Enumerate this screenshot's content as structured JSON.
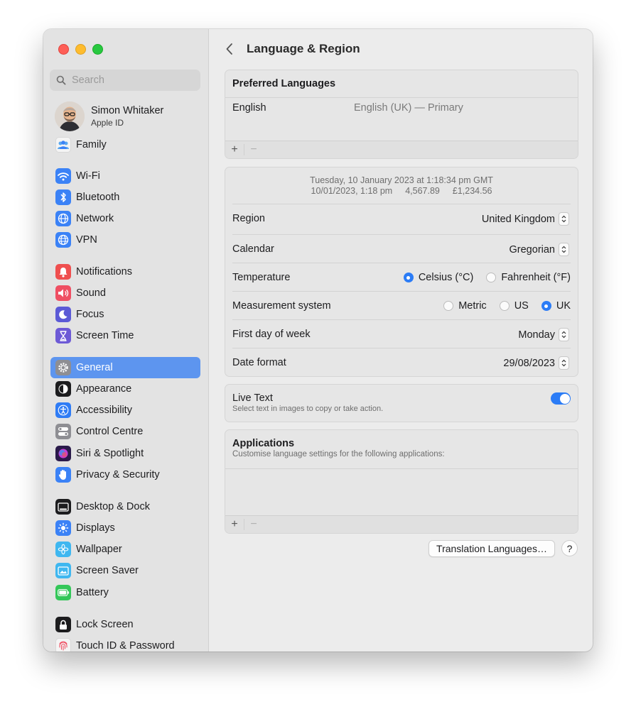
{
  "sidebar": {
    "search_placeholder": "Search",
    "profile": {
      "name": "Simon Whitaker",
      "subtitle": "Apple ID"
    },
    "items": [
      {
        "label": "Family",
        "icon": "family-icon",
        "color": "#f2f2f2"
      },
      {
        "label": "Wi-Fi",
        "icon": "wifi-icon",
        "color": "#3b82f6"
      },
      {
        "label": "Bluetooth",
        "icon": "bluetooth-icon",
        "color": "#3b82f6"
      },
      {
        "label": "Network",
        "icon": "network-globe-icon",
        "color": "#3b82f6"
      },
      {
        "label": "VPN",
        "icon": "vpn-globe-icon",
        "color": "#3b82f6"
      },
      {
        "label": "Notifications",
        "icon": "notifications-bell-icon",
        "color": "#ef4f4f"
      },
      {
        "label": "Sound",
        "icon": "speaker-icon",
        "color": "#ef4f63"
      },
      {
        "label": "Focus",
        "icon": "moon-icon",
        "color": "#5b5ad6"
      },
      {
        "label": "Screen Time",
        "icon": "hourglass-icon",
        "color": "#6d5ad6"
      },
      {
        "label": "General",
        "icon": "gear-icon",
        "color": "#8e8e93"
      },
      {
        "label": "Appearance",
        "icon": "appearance-icon",
        "color": "#1c1c1e"
      },
      {
        "label": "Accessibility",
        "icon": "accessibility-icon",
        "color": "#2f7cf5"
      },
      {
        "label": "Control Centre",
        "icon": "control-centre-icon",
        "color": "#8e8e93"
      },
      {
        "label": "Siri & Spotlight",
        "icon": "siri-icon",
        "color": "#7a3fd1"
      },
      {
        "label": "Privacy & Security",
        "icon": "hand-icon",
        "color": "#3b82f6"
      },
      {
        "label": "Desktop & Dock",
        "icon": "desktop-dock-icon",
        "color": "#1c1c1e"
      },
      {
        "label": "Displays",
        "icon": "sun-icon",
        "color": "#3b82f6"
      },
      {
        "label": "Wallpaper",
        "icon": "wallpaper-flower-icon",
        "color": "#3fb7f0"
      },
      {
        "label": "Screen Saver",
        "icon": "screen-saver-icon",
        "color": "#3fb7f0"
      },
      {
        "label": "Battery",
        "icon": "battery-icon",
        "color": "#34c759"
      },
      {
        "label": "Lock Screen",
        "icon": "lock-icon",
        "color": "#1c1c1e"
      },
      {
        "label": "Touch ID & Password",
        "icon": "fingerprint-icon",
        "color": "#f0f0f0"
      }
    ]
  },
  "main": {
    "title": "Language & Region",
    "preferred_languages": {
      "header": "Preferred Languages",
      "language": "English",
      "detail": "English (UK) — Primary",
      "add": "+",
      "remove": "−"
    },
    "preview": {
      "line1": "Tuesday, 10 January 2023 at 1:18:34 pm GMT",
      "date_time": "10/01/2023, 1:18 pm",
      "number": "4,567.89",
      "currency": "£1,234.56"
    },
    "region": {
      "label": "Region",
      "value": "United Kingdom"
    },
    "calendar": {
      "label": "Calendar",
      "value": "Gregorian"
    },
    "temperature": {
      "label": "Temperature",
      "options": [
        "Celsius (°C)",
        "Fahrenheit (°F)"
      ],
      "selected": "Celsius (°C)"
    },
    "measurement": {
      "label": "Measurement system",
      "options": [
        "Metric",
        "US",
        "UK"
      ],
      "selected": "UK"
    },
    "first_day": {
      "label": "First day of week",
      "value": "Monday"
    },
    "date_format": {
      "label": "Date format",
      "value": "29/08/2023"
    },
    "live_text": {
      "label": "Live Text",
      "description": "Select text in images to copy or take action.",
      "enabled": true
    },
    "applications": {
      "header": "Applications",
      "description": "Customise language settings for the following applications:",
      "add": "+",
      "remove": "−"
    },
    "translation_button": "Translation Languages…",
    "help_label": "?",
    "accent_color": "#2b7cf6",
    "selection_color": "#5d95ef"
  }
}
